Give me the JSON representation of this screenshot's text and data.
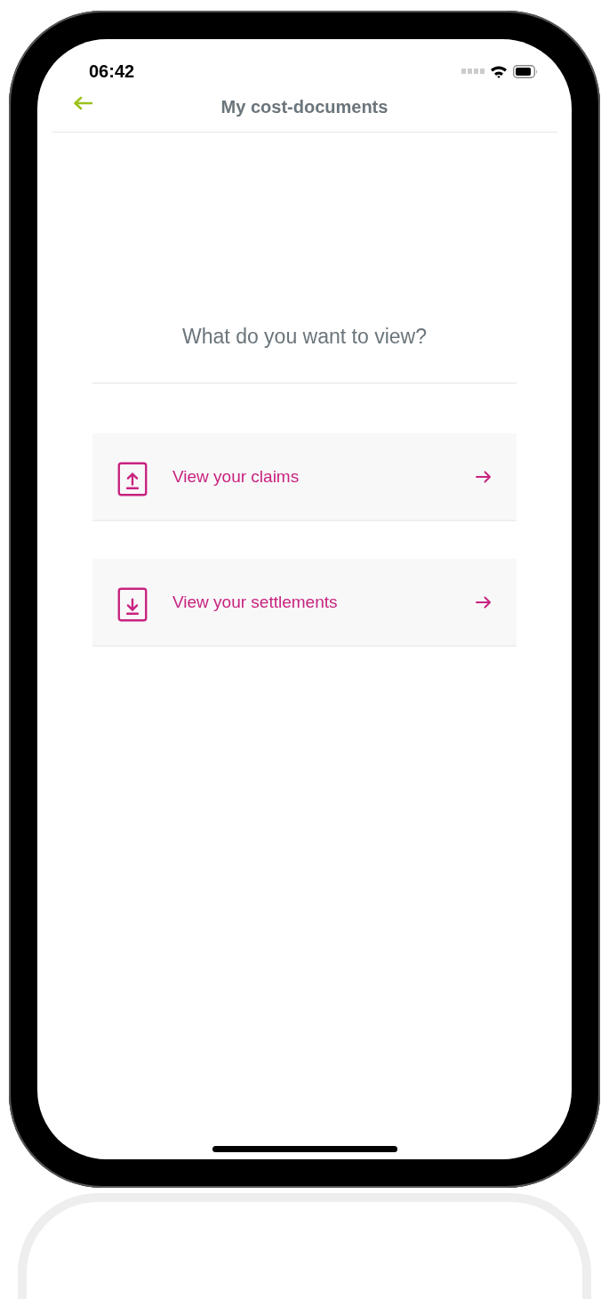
{
  "status_bar": {
    "time": "06:42"
  },
  "header": {
    "title": "My cost-documents"
  },
  "question": "What do you want to view?",
  "options": [
    {
      "kind": "upload",
      "label": "View your claims"
    },
    {
      "kind": "download",
      "label": "View your settlements"
    }
  ]
}
